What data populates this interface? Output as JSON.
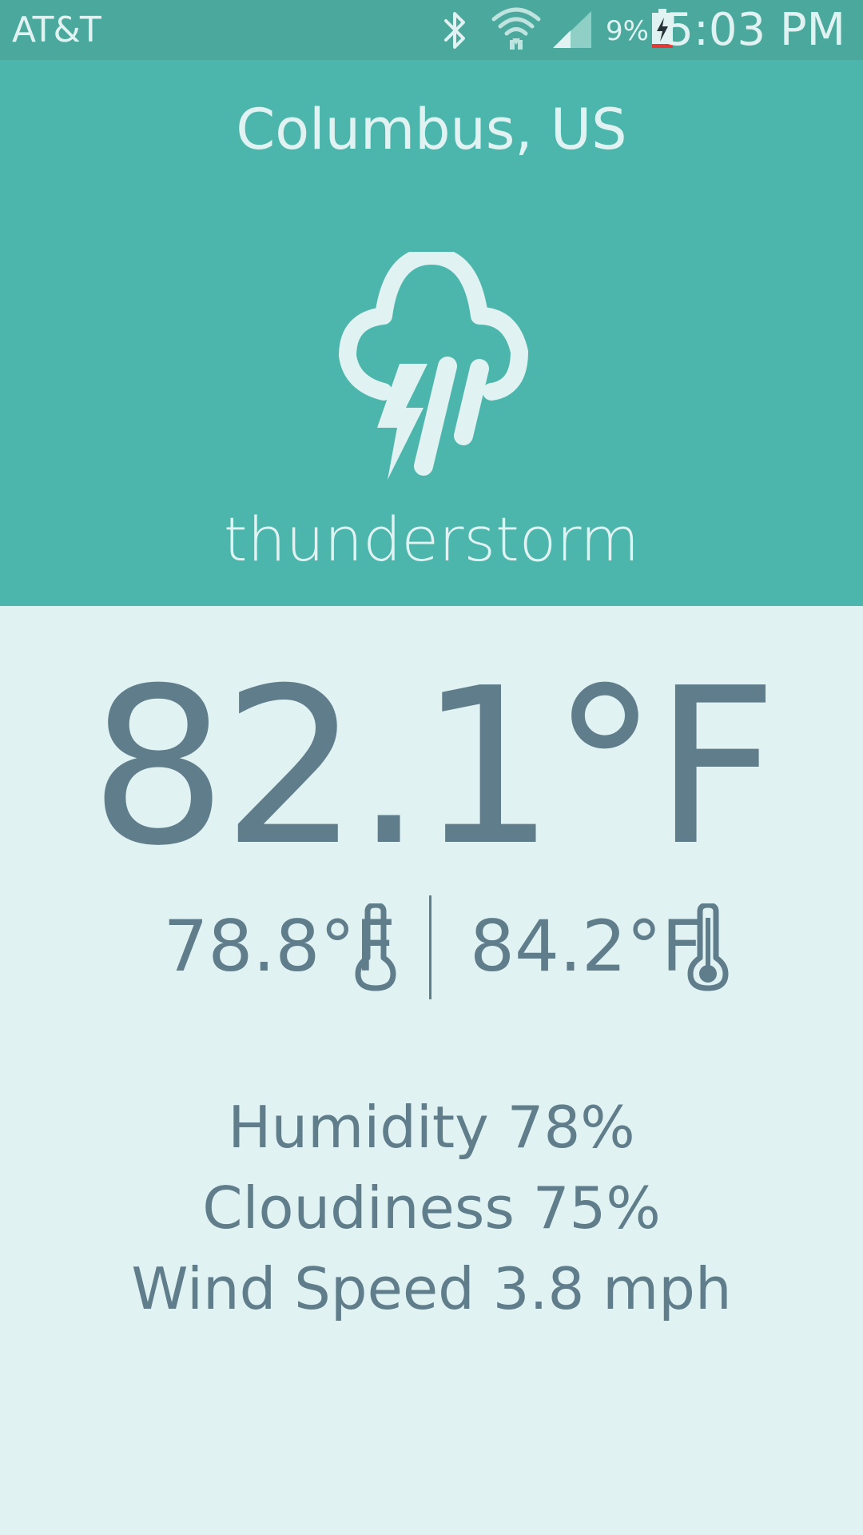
{
  "status_bar": {
    "carrier": "AT&T",
    "battery_percent": "9%",
    "time": "5:03 PM",
    "icons": [
      "bluetooth-icon",
      "wifi-icon",
      "cell-signal-icon",
      "battery-charging-icon"
    ]
  },
  "weather": {
    "location": "Columbus, US",
    "condition": "thunderstorm",
    "condition_icon": "thunderstorm-icon",
    "temperature": "82.1°F",
    "temp_min": "78.8°F",
    "temp_max": "84.2°F",
    "humidity": "Humidity 78%",
    "cloudiness": "Cloudiness 75%",
    "wind_speed": "Wind Speed 3.8 mph"
  },
  "colors": {
    "status_bar_bg": "#4AA89C",
    "header_bg": "#4DB6AC",
    "body_bg": "#E0F2F1",
    "text_primary": "#607D8B",
    "text_on_header": "#E0F2F1"
  }
}
